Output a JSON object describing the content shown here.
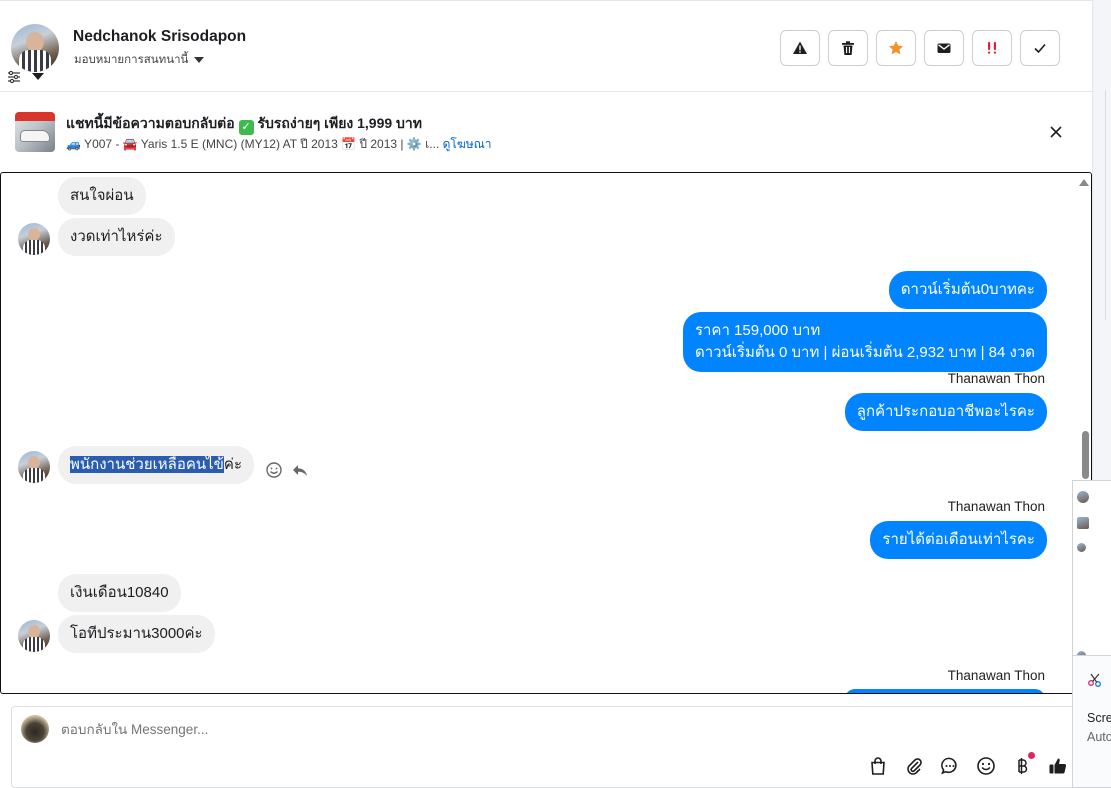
{
  "header": {
    "contact_name": "Nedchanok Srisodapon",
    "assign_label": "มอบหมายการสนทนานี้",
    "actions": [
      "warning-icon",
      "trash-icon",
      "star-icon",
      "mail-icon",
      "urgent-icon",
      "check-icon"
    ],
    "star_color": "#f2922b",
    "urgent_color": "#e41e3f"
  },
  "ad": {
    "title": "แชทนี้มีข้อความตอบกลับต่อ ✅ รับรถง่ายๆ เพียง 1,999 บาท",
    "title_text": "แชทนี้มีข้อความตอบกลับต่อ",
    "title_rest": "รับรถง่ายๆ เพียง 1,999 บาท",
    "subtitle": "🚙 Y007 - 🚘 Yaris 1.5 E (MNC) (MY12) AT ปี 2013 📅 ปี 2013 | ⚙️ เ...",
    "link": "ดูโฆษณา"
  },
  "messages": [
    {
      "id": "m1",
      "dir": "in",
      "text": "สนใจผ่อน"
    },
    {
      "id": "m2",
      "dir": "in",
      "text": "งวดเท่าไหร่ค่ะ"
    },
    {
      "id": "m3",
      "dir": "out",
      "text": "ดาวน์เริ่มต้น0บาทคะ"
    },
    {
      "id": "m4",
      "dir": "out",
      "line1": "ราคา 159,000 บาท",
      "line2": "ดาวน์เริ่มต้น 0 บาท | ผ่อนเริ่มต้น 2,932 บาท | 84 งวด"
    },
    {
      "id": "m5",
      "dir": "out",
      "sender": "Thanawan Thon",
      "text": "ลูกค้าประกอบอาชีพอะไรคะ"
    },
    {
      "id": "m6",
      "dir": "in",
      "text_selected": "พนักงานช่วยเหลือคนไข้",
      "text_rest": "ค่ะ"
    },
    {
      "id": "m7",
      "dir": "out",
      "sender": "Thanawan Thon",
      "text": "รายได้ต่อเดือนเท่าไรคะ"
    },
    {
      "id": "m8",
      "dir": "in",
      "text": "เงินเดือน10840"
    },
    {
      "id": "m9",
      "dir": "in",
      "text": "โอทีประมาน3000ค่ะ"
    },
    {
      "id": "m10",
      "dir": "out",
      "sender": "Thanawan Thon"
    }
  ],
  "composer": {
    "placeholder": "ตอบกลับใน Messenger...",
    "tools": [
      "bag-icon",
      "paperclip-icon",
      "chat-icon",
      "emoji-icon",
      "baht-icon",
      "thumbs-up-icon"
    ]
  },
  "side": {
    "toast_line1": "Scre",
    "toast_line2": "Auto"
  },
  "colors": {
    "outgoing_bubble": "#0084ff",
    "incoming_bubble": "#f0f0f0",
    "selection": "#2a5db0",
    "link": "#0064d1"
  }
}
